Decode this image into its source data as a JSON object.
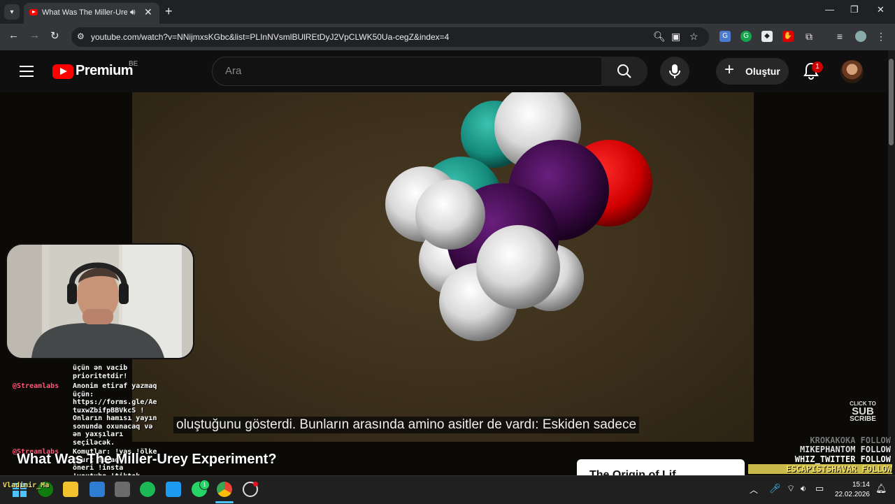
{
  "browser": {
    "tab_title": "What Was The Miller-Urey E",
    "url": "youtube.com/watch?v=NNijmxsKGbc&list=PLInNVsmlBUlREtDyJ2VpCLWK50Ua-cegZ&index=4"
  },
  "youtube": {
    "brand": "Premium",
    "region": "BE",
    "search_placeholder": "Ara",
    "create_label": "Oluştur",
    "notification_count": "1"
  },
  "video": {
    "subtitle": "oluştuğunu gösterdi. Bunların arasında amino asitler de vardı: Eskiden sadece",
    "title": "What Was The Miller-Urey Experiment?",
    "end_card_title": "The Origin of Lif"
  },
  "overlay": {
    "chat_lines": [
      {
        "user": "",
        "text": "üçün ən vacib\nprioritetdir!"
      },
      {
        "user": "@Streamlabs",
        "text": "Anonim etiraf yazmaq\nüçün:\nhttps://forms.gle/Ae\ntuxwZbifpBBVkcS !\nOnların hamısı yayın\nsonunda oxunacaq və\nən yaxşıları\nseçiləcək."
      },
      {
        "user": "@Streamlabs",
        "text": "Komutlar: !yaş !ölke\n!burç !uzaq\nöneri !insta\n!youtube !tiktok\nreis beni bidip\ngeliom hemen"
      }
    ],
    "chat_taskbar_user": "Vladimir_Ma",
    "follows": [
      "KROKAKOKA FOLLOW",
      "MIKEPHANTOM FOLLOW",
      "WHIZ_TWITTER FOLLOW",
      "ESCAPISTSHAVAR FOLLOW"
    ],
    "click_to_subscribe": [
      "CLICK TO",
      "SUB",
      "SCRIBE"
    ]
  },
  "taskbar": {
    "time": "15:14",
    "date": "22.02.2026",
    "whatsapp_badge": "1"
  },
  "colors": {
    "youtube_red": "#ff0000",
    "molecule_purple": "#3a0a4a",
    "molecule_teal": "#1a8f82",
    "molecule_red": "#e00000"
  }
}
